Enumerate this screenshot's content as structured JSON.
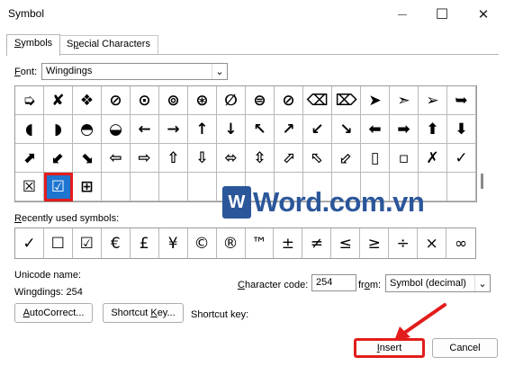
{
  "window": {
    "title": "Symbol",
    "minimize_glyph": "—",
    "maximize_glyph": "☐",
    "close_glyph": "✕"
  },
  "tabs": [
    {
      "label": "Symbols",
      "mnemonic": "S",
      "rest": "ymbols"
    },
    {
      "label": "Special Characters",
      "pre": "S",
      "mnemonic": "p",
      "rest": "ecial Characters"
    }
  ],
  "font": {
    "label": "Font:",
    "mnemonic": "F",
    "rest": "ont:",
    "value": "Wingdings",
    "chevron": "⌄"
  },
  "symbol_grid": {
    "rows": [
      [
        "➭",
        "✘",
        "❖",
        "⊘",
        "⊙",
        "⊚",
        "⊛",
        "∅",
        "⊜",
        "⊘",
        "⌫",
        "⌦",
        "➤",
        "➣",
        "➢",
        "➥"
      ],
      [
        "◖",
        "◗",
        "◓",
        "◒",
        "←",
        "→",
        "↑",
        "↓",
        "↖",
        "↗",
        "↙",
        "↘",
        "⬅",
        "➡",
        "⬆",
        "⬇"
      ],
      [
        "⬈",
        "⬋",
        "⬊",
        "⇦",
        "⇨",
        "⇧",
        "⇩",
        "⬄",
        "⇳",
        "⬀",
        "⬁",
        "⬃",
        "▯",
        "▫",
        "✗",
        "✓"
      ],
      [
        "☒",
        "☑",
        "⊞",
        "",
        "",
        "",
        "",
        "",
        "",
        "",
        "",
        "",
        "",
        "",
        "",
        ""
      ]
    ],
    "selected_row": 3,
    "selected_col": 1
  },
  "watermark": {
    "logo_letter": "W",
    "text": "Word.com.vn"
  },
  "recent": {
    "label": "Recently used symbols:",
    "mnemonic": "R",
    "rest": "ecently used symbols:",
    "symbols": [
      "✓",
      "☐",
      "☑",
      "€",
      "£",
      "¥",
      "©",
      "®",
      "™",
      "±",
      "≠",
      "≤",
      "≥",
      "÷",
      "×",
      "∞"
    ]
  },
  "unicode": {
    "label": "Unicode name:",
    "value": "Wingdings: 254"
  },
  "character_code": {
    "label": "Character code:",
    "mnemonic": "C",
    "rest": "haracter code:",
    "value": "254"
  },
  "from": {
    "label": "from:",
    "pre": "fr",
    "mnemonic": "o",
    "rest": "m:",
    "value": "Symbol (decimal)",
    "chevron": "⌄"
  },
  "buttons": {
    "autocorrect": {
      "label": "AutoCorrect...",
      "mnemonic": "A",
      "rest": "utoCorrect..."
    },
    "shortcut_key": {
      "label": "Shortcut Key...",
      "pre": "Shortcut ",
      "mnemonic": "K",
      "rest": "ey..."
    },
    "insert": {
      "label": "Insert",
      "mnemonic": "I",
      "rest": "nsert"
    },
    "cancel": {
      "label": "Cancel"
    }
  },
  "shortcut_key_label": "Shortcut key:",
  "colors": {
    "highlight": "#e31c1c",
    "selection": "#1d75d0",
    "watermark": "#2b579a"
  }
}
